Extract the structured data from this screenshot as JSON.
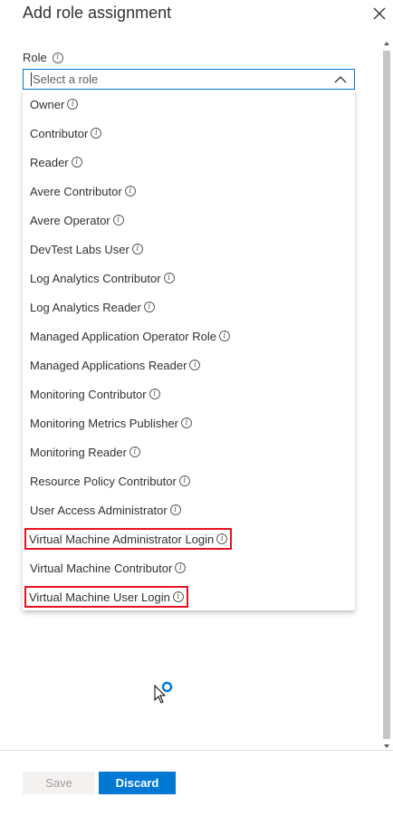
{
  "blade": {
    "title": "Add role assignment"
  },
  "role_field": {
    "label": "Role",
    "placeholder": "Select a role",
    "options": [
      {
        "label": "Owner",
        "highlighted": false
      },
      {
        "label": "Contributor",
        "highlighted": false
      },
      {
        "label": "Reader",
        "highlighted": false
      },
      {
        "label": "Avere Contributor",
        "highlighted": false
      },
      {
        "label": "Avere Operator",
        "highlighted": false
      },
      {
        "label": "DevTest Labs User",
        "highlighted": false
      },
      {
        "label": "Log Analytics Contributor",
        "highlighted": false
      },
      {
        "label": "Log Analytics Reader",
        "highlighted": false
      },
      {
        "label": "Managed Application Operator Role",
        "highlighted": false
      },
      {
        "label": "Managed Applications Reader",
        "highlighted": false
      },
      {
        "label": "Monitoring Contributor",
        "highlighted": false
      },
      {
        "label": "Monitoring Metrics Publisher",
        "highlighted": false
      },
      {
        "label": "Monitoring Reader",
        "highlighted": false
      },
      {
        "label": "Resource Policy Contributor",
        "highlighted": false
      },
      {
        "label": "User Access Administrator",
        "highlighted": false
      },
      {
        "label": "Virtual Machine Administrator Login",
        "highlighted": true
      },
      {
        "label": "Virtual Machine Contributor",
        "highlighted": false
      },
      {
        "label": "Virtual Machine User Login",
        "highlighted": true
      }
    ]
  },
  "footer": {
    "save_label": "Save",
    "discard_label": "Discard"
  },
  "colors": {
    "accent": "#0078d4",
    "highlight_box": "#e81123"
  },
  "icons": {
    "info": "info-icon",
    "close": "close-icon",
    "chevron": "chevron-up-icon",
    "loading": "loading-spinner-icon"
  }
}
